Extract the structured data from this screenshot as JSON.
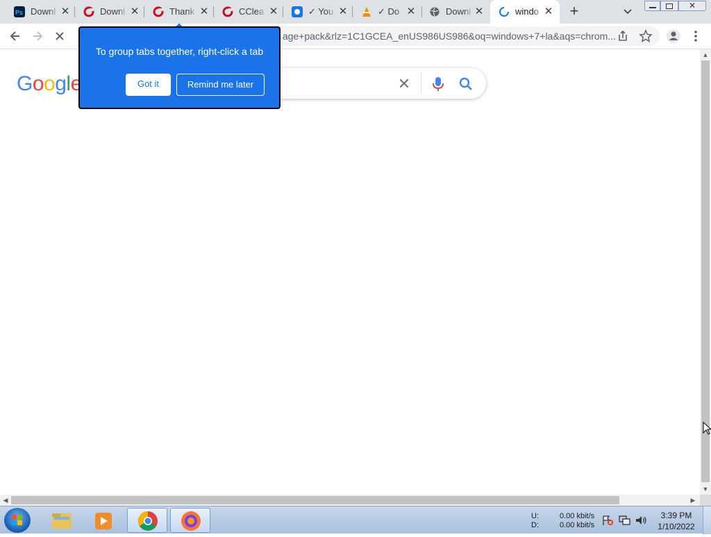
{
  "tabs": [
    {
      "title": "Downl",
      "icon": "photoshop-icon",
      "color": "#001e36"
    },
    {
      "title": "Downl",
      "icon": "ccleaner-icon",
      "color": "#c8102e"
    },
    {
      "title": "Thank",
      "icon": "ccleaner-icon",
      "color": "#c8102e"
    },
    {
      "title": "CClea",
      "icon": "ccleaner-icon",
      "color": "#c8102e"
    },
    {
      "title": "✓ You",
      "icon": "app-icon",
      "color": "#1a73e8"
    },
    {
      "title": "✓ Do",
      "icon": "vlc-icon",
      "color": "#ff8800"
    },
    {
      "title": "Downl",
      "icon": "globe-icon",
      "color": "#5f6368"
    },
    {
      "title": "windo",
      "icon": "loading-icon",
      "color": "#1a73e8"
    }
  ],
  "omnibox": {
    "url": "age+pack&rlz=1C1GCEA_enUS986US986&oq=windows+7+la&aqs=chrom..."
  },
  "google_logo": "Google",
  "callout": {
    "text": "To group tabs together, right-click a tab",
    "got_it": "Got it",
    "remind_later": "Remind me later"
  },
  "tray": {
    "upload_label": "U:",
    "download_label": "D:",
    "upload_rate": "0.00 kbit/s",
    "download_rate": "0.00 kbit/s",
    "time": "3:39 PM",
    "date": "1/10/2022"
  },
  "colors": {
    "accent": "#1a73e8",
    "tabstrip": "#dee1e6"
  }
}
